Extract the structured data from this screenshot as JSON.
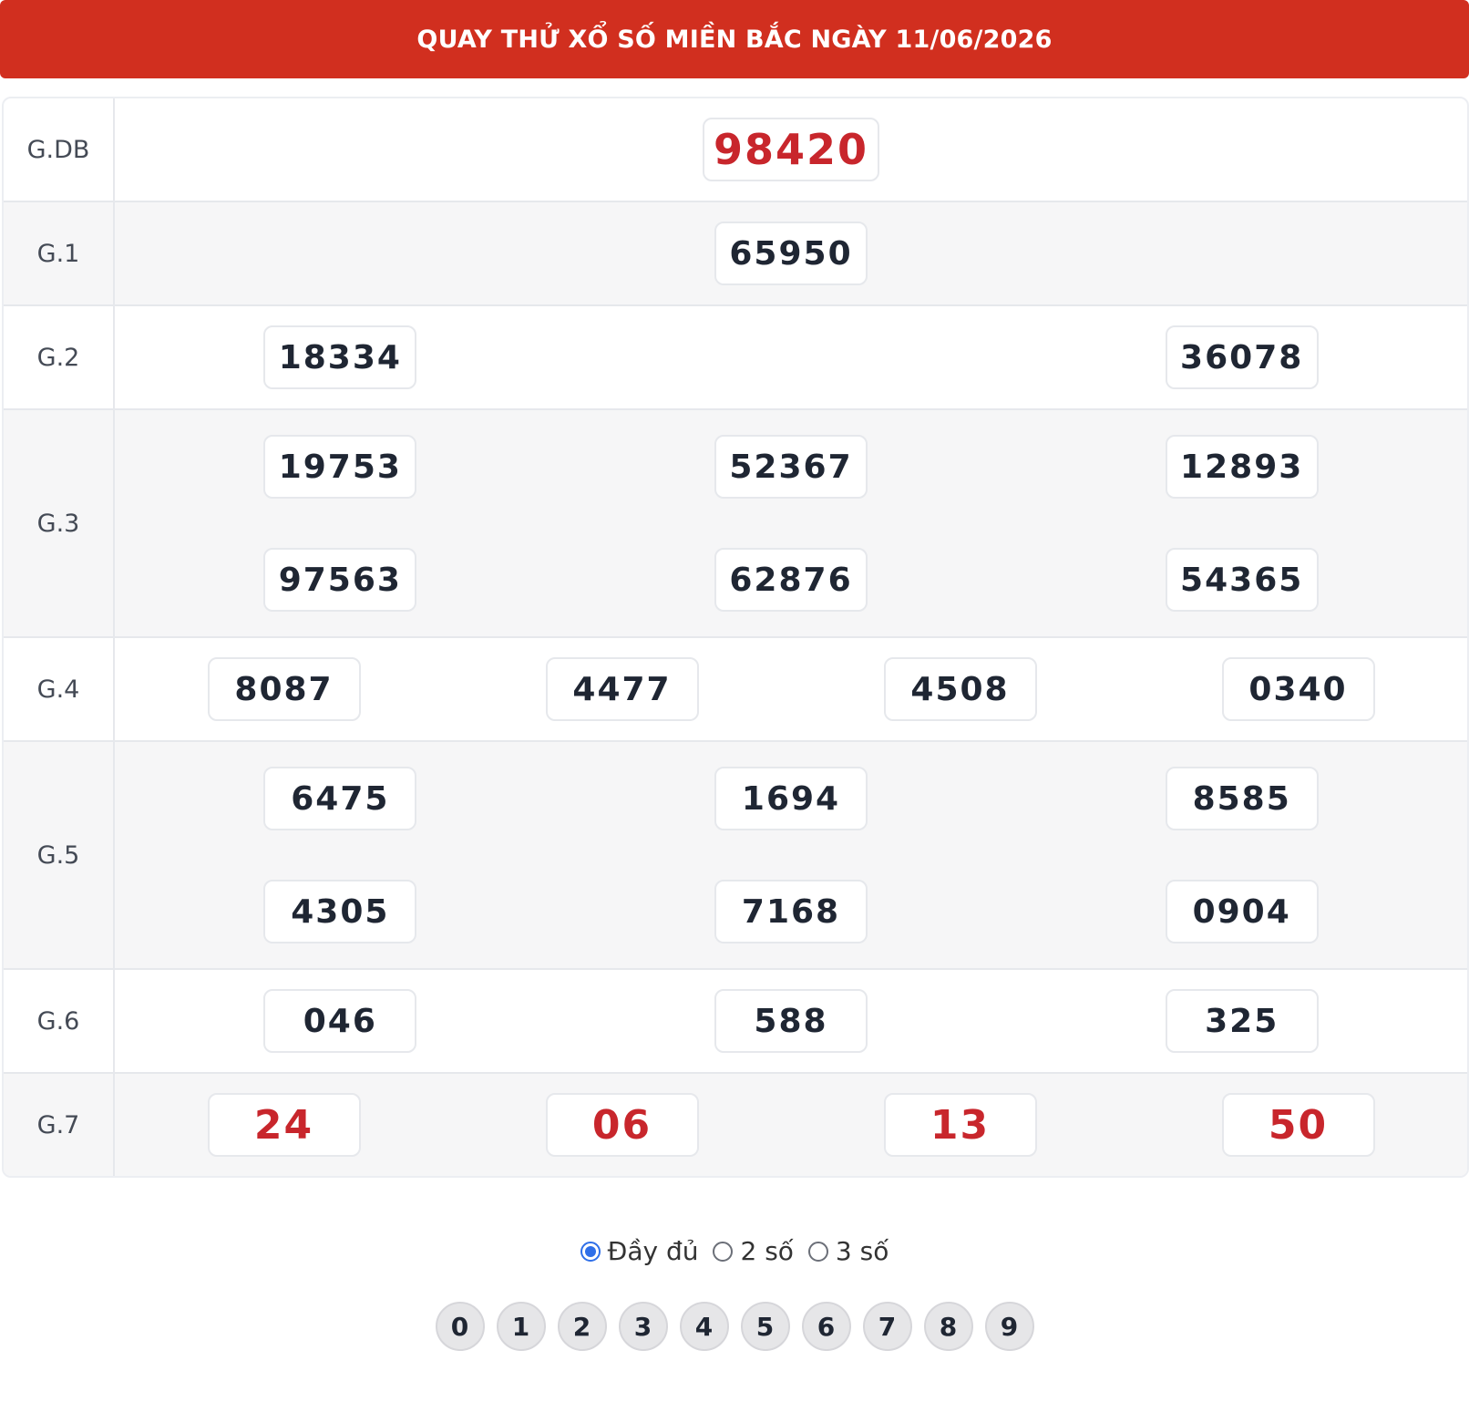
{
  "header": {
    "title": "QUAY THỬ XỔ SỐ MIỀN BẮC NGÀY 11/06/2026"
  },
  "prizes": {
    "gdb": {
      "label": "G.DB",
      "numbers": [
        "98420"
      ]
    },
    "g1": {
      "label": "G.1",
      "numbers": [
        "65950"
      ]
    },
    "g2": {
      "label": "G.2",
      "numbers": [
        "18334",
        "36078"
      ]
    },
    "g3": {
      "label": "G.3",
      "numbers": [
        "19753",
        "52367",
        "12893",
        "97563",
        "62876",
        "54365"
      ]
    },
    "g4": {
      "label": "G.4",
      "numbers": [
        "8087",
        "4477",
        "4508",
        "0340"
      ]
    },
    "g5": {
      "label": "G.5",
      "numbers": [
        "6475",
        "1694",
        "8585",
        "4305",
        "7168",
        "0904"
      ]
    },
    "g6": {
      "label": "G.6",
      "numbers": [
        "046",
        "588",
        "325"
      ]
    },
    "g7": {
      "label": "G.7",
      "numbers": [
        "24",
        "06",
        "13",
        "50"
      ]
    }
  },
  "display_options": [
    {
      "label": "Đầy đủ",
      "selected": true
    },
    {
      "label": "2 số",
      "selected": false
    },
    {
      "label": "3 số",
      "selected": false
    }
  ],
  "digit_filters": [
    "0",
    "1",
    "2",
    "3",
    "4",
    "5",
    "6",
    "7",
    "8",
    "9"
  ],
  "colors": {
    "header_bg": "#d12f1f",
    "highlight": "#c8262c",
    "radio_selected": "#2f6fe8"
  }
}
